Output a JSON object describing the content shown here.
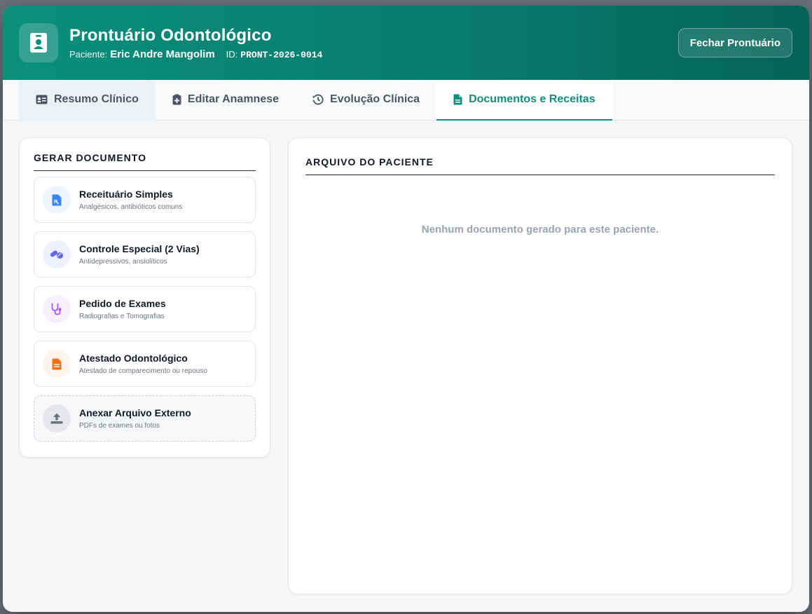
{
  "header": {
    "title": "Prontuário Odontológico",
    "patient_label": "Paciente:",
    "patient_name": "Eric Andre Mangolim",
    "id_label": "ID:",
    "id_value": "PRONT-2026-0014",
    "close_label": "Fechar Prontuário",
    "icon": "id-badge-icon"
  },
  "tabs": [
    {
      "label": "Resumo Clínico",
      "icon": "id-card-icon"
    },
    {
      "label": "Editar Anamnese",
      "icon": "clipboard-plus-icon"
    },
    {
      "label": "Evolução Clínica",
      "icon": "history-icon"
    },
    {
      "label": "Documentos e Receitas",
      "icon": "document-icon",
      "active": true
    }
  ],
  "generate": {
    "title": "GERAR DOCUMENTO",
    "items": [
      {
        "title": "Receituário Simples",
        "subtitle": "Analgésicos, antibióticos comuns",
        "icon": "prescription-icon",
        "color": "#3b82f6"
      },
      {
        "title": "Controle Especial (2 Vias)",
        "subtitle": "Antidepressivos, ansiolíticos",
        "icon": "pills-icon",
        "color": "#6366f1"
      },
      {
        "title": "Pedido de Exames",
        "subtitle": "Radiografias e Tomografias",
        "icon": "stethoscope-icon",
        "color": "#a855f7"
      },
      {
        "title": "Atestado Odontológico",
        "subtitle": "Atestado de comparecimento ou repouso",
        "icon": "certificate-icon",
        "color": "#f97316"
      },
      {
        "title": "Anexar Arquivo Externo",
        "subtitle": "PDFs de exames ou fotos",
        "icon": "upload-icon",
        "color": "#6b7280"
      }
    ]
  },
  "archive": {
    "title": "ARQUIVO DO PACIENTE",
    "empty_message": "Nenhum documento gerado para este paciente."
  },
  "colors": {
    "primary": "#0d8f7e",
    "header_gradient_start": "#0b8f7c",
    "header_gradient_end": "#056358"
  }
}
